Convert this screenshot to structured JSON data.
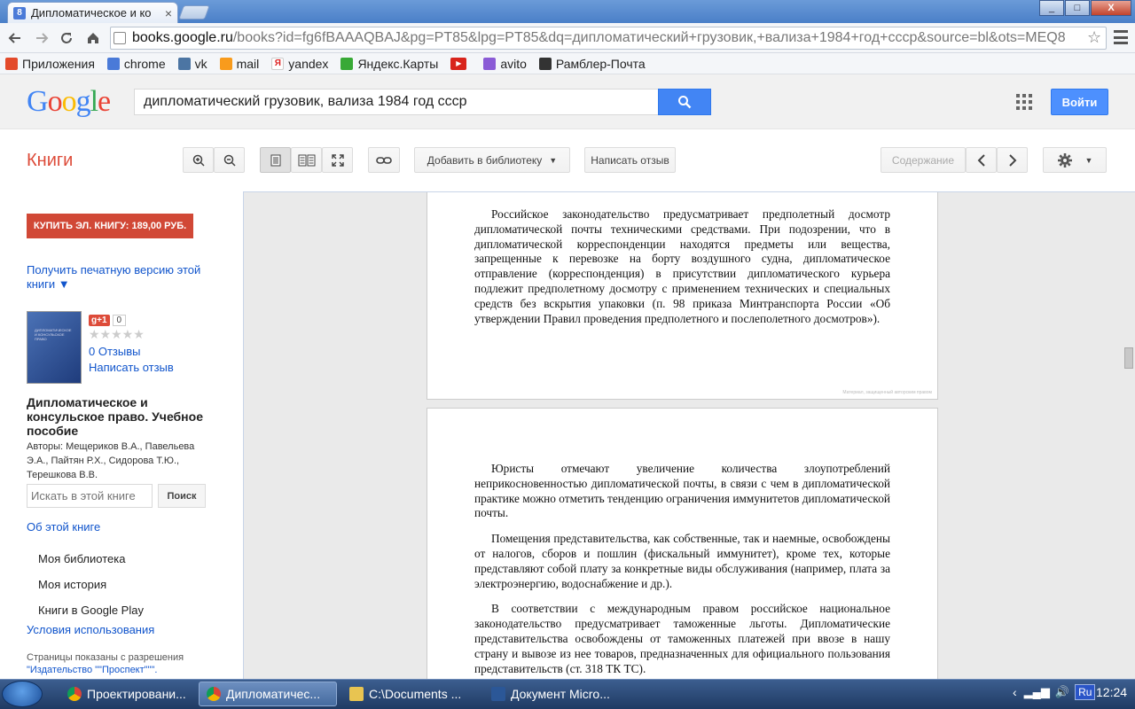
{
  "browser": {
    "tab_title": "Дипломатическое и ко",
    "tab_close": "×",
    "window_min": "_",
    "window_max": "□",
    "window_close": "X",
    "url_host": "books.google.ru",
    "url_rest": "/books?id=fg6fBAAAQBAJ&pg=PT85&lpg=PT85&dq=дипломатический+грузовик,+вализа+1984+год+ссср&source=bl&ots=MEQ8"
  },
  "bookmarks": [
    {
      "label": "Приложения",
      "icon": "apps-grid-icon",
      "color": "#e34a2b"
    },
    {
      "label": "chrome",
      "icon": "google-g-icon",
      "color": "#4a7ad8"
    },
    {
      "label": "vk",
      "icon": "vk-icon",
      "color": "#4c75a3"
    },
    {
      "label": "mail",
      "icon": "mail-at-icon",
      "color": "#f89b1c"
    },
    {
      "label": "yandex",
      "icon": "yandex-icon",
      "color": "#ffffff"
    },
    {
      "label": "Яндекс.Карты",
      "icon": "yandex-maps-icon",
      "color": "#38a936"
    },
    {
      "label": "",
      "icon": "youtube-icon",
      "color": "#d8241c"
    },
    {
      "label": "avito",
      "icon": "avito-icon",
      "color": "#8a5bd6"
    },
    {
      "label": "Рамблер-Почта",
      "icon": "rambler-mail-icon",
      "color": "#333333"
    }
  ],
  "google": {
    "logo": "Google",
    "search_value": "дипломатический грузовик, вализа 1984 год ссср",
    "signin": "Войти"
  },
  "books_toolbar": {
    "section": "Книги",
    "add_library": "Добавить в библиотеку",
    "write_review": "Написать отзыв",
    "contents": "Содержание"
  },
  "sidebar": {
    "buy": "КУПИТЬ ЭЛ. КНИГУ: 189,00 РУБ.",
    "print_version": "Получить печатную версию этой книги ▼",
    "gplus": "g+1",
    "gplus_count": "0",
    "stars": "★★★★★",
    "reviews": "0 Отзывы",
    "write_review": "Написать отзыв",
    "book_title": "Дипломатическое и консульское право. Учебное пособие",
    "authors": "Авторы: Мещериков В.А., Павельева Э.А., Пайтян Р.Х., Сидорова Т.Ю., Терешкова В.В.",
    "search_placeholder": "Искать в этой книге",
    "search_button": "Поиск",
    "about": "Об этой книге",
    "my_library": "Моя библиотека",
    "my_history": "Моя история",
    "play_books": "Книги в Google Play",
    "terms": "Условия использования",
    "permission_prefix": "Страницы показаны с разрешения",
    "permission_publisher": "\"Издательство \"\"Проспект\"\"\"."
  },
  "page1": {
    "paragraph": "Российское законодательство предусматривает предполетный досмотр дипломатической почты техническими средствами. При подозрении, что в дипломатической корреспонденции находятся предметы или вещества, запрещенные к перевозке на борту воздушного судна, дипломатическое отправление (корреспонденция) в присутствии дипломатического курьера подлежит предполетному досмотру с применением технических и специальных средств без вскрытия упаковки (п. 98 приказа Минтранспорта России «Об утверждении Правил проведения предполетного и послеполетного досмотров»).",
    "watermark": "Материал, защищенный авторским правом"
  },
  "page2": {
    "p1": "Юристы отмечают увеличение количества злоупотреблений неприкосновенностью дипломатической почты, в связи с чем в дипломатической практике можно отметить тенденцию ограничения иммунитетов дипломатической почты.",
    "p2": "Помещения представительства, как собственные, так и наемные, освобождены от налогов, сборов и пошлин (фискальный иммунитет), кроме тех, которые представляют собой плату за конкретные виды обслуживания (например, плата за электроэнергию, водоснабжение и др.).",
    "p3": "В соответствии с международным правом российское национальное законодательство предусматривает таможенные льготы. Дипломатические представительства освобождены от таможенных платежей при ввозе в нашу страну и вывозе из нее товаров, предназначенных для официального пользования представительств (ст. 318 ТК ТС)."
  },
  "taskbar": {
    "tasks": [
      "Проектировани...",
      "Дипломатичес...",
      "C:\\Documents ...",
      "Документ Micro..."
    ],
    "lang": "Ru",
    "clock": "12:24"
  }
}
